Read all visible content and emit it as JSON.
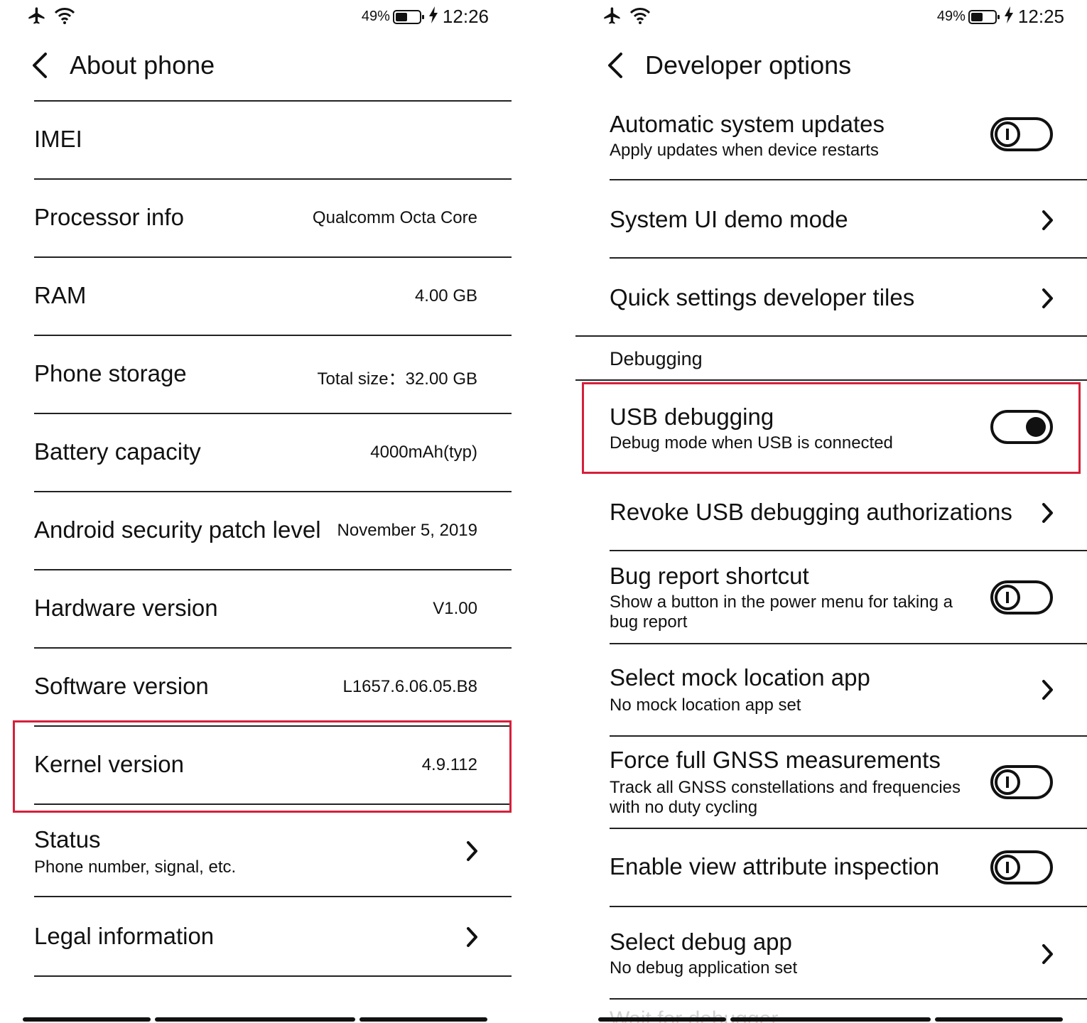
{
  "left": {
    "status": {
      "battery": "49%",
      "time": "12:26"
    },
    "header": {
      "title": "About phone"
    },
    "rows": [
      {
        "label": "IMEI",
        "value": ""
      },
      {
        "label": "Processor info",
        "value": "Qualcomm Octa Core"
      },
      {
        "label": "RAM",
        "value": "4.00 GB"
      },
      {
        "label": "Phone storage",
        "value": "Total size：32.00 GB"
      },
      {
        "label": "Battery capacity",
        "value": "4000mAh(typ)"
      },
      {
        "label": "Android security patch level",
        "value": "November 5, 2019"
      },
      {
        "label": "Hardware version",
        "value": "V1.00"
      },
      {
        "label": "Software version",
        "value": "L1657.6.06.05.B8"
      },
      {
        "label": "Kernel version",
        "value": "4.9.112"
      },
      {
        "label": "Status",
        "sub": "Phone number, signal, etc."
      },
      {
        "label": "Legal information"
      }
    ]
  },
  "right": {
    "status": {
      "battery": "49%",
      "time": "12:25"
    },
    "header": {
      "title": "Developer options"
    },
    "rows": [
      {
        "label": "Automatic system updates",
        "sub": "Apply updates when device restarts",
        "toggle": "off"
      },
      {
        "label": "System UI demo mode"
      },
      {
        "label": "Quick settings developer tiles"
      },
      {
        "section": "Debugging"
      },
      {
        "label": "USB debugging",
        "sub": "Debug mode when USB is connected",
        "toggle": "on"
      },
      {
        "label": "Revoke USB debugging authorizations"
      },
      {
        "label": "Bug report shortcut",
        "sub": "Show a button in the power menu for taking a bug report",
        "toggle": "off"
      },
      {
        "label": "Select mock location app",
        "sub": "No mock location app set"
      },
      {
        "label": "Force full GNSS measurements",
        "sub": "Track all GNSS constellations and frequencies with no duty cycling",
        "toggle": "off"
      },
      {
        "label": "Enable view attribute inspection",
        "toggle": "off"
      },
      {
        "label": "Select debug app",
        "sub": "No debug application set"
      },
      {
        "label": "Wait for debugger"
      }
    ]
  },
  "battery_level": 0.49,
  "colors": {
    "highlight": "#d6203a",
    "text": "#111111",
    "divider": "#222222"
  },
  "icons": [
    "airplane-icon",
    "wifi-icon",
    "battery-icon",
    "charging-icon",
    "back-arrow-icon",
    "chevron-right-icon",
    "toggle-off-icon",
    "toggle-on-icon"
  ]
}
